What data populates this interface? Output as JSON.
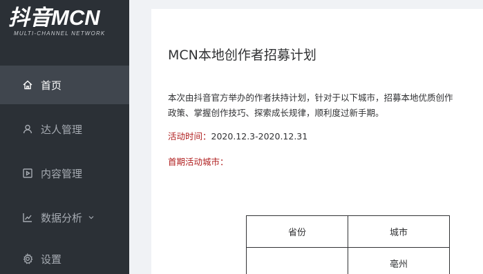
{
  "brand": {
    "logo_main": "抖音MCN",
    "logo_sub": "MULTI-CHANNEL NETWORK"
  },
  "sidebar": {
    "items": [
      {
        "label": "首页",
        "icon": "home-icon",
        "active": true
      },
      {
        "label": "达人管理",
        "icon": "user-icon",
        "active": false
      },
      {
        "label": "内容管理",
        "icon": "play-square-icon",
        "active": false
      },
      {
        "label": "数据分析",
        "icon": "line-chart-icon",
        "active": false,
        "has_dropdown": true
      },
      {
        "label": "设置",
        "icon": "gear-icon",
        "active": false
      }
    ]
  },
  "main": {
    "title": "MCN本地创作者招募计划",
    "intro_line1": "本次由抖音官方举办的作者扶持计划，针对于以下城市，招募本地优质创作",
    "intro_line2": "政策、掌握创作技巧、探索成长规律，顺利度过新手期。",
    "activity_time_label": "活动时间：",
    "activity_time_value": "2020.12.3-2020.12.31",
    "cities_label": "首期活动城市：",
    "table": {
      "headers": [
        "省份",
        "城市"
      ],
      "rows": [
        [
          "",
          "亳州"
        ]
      ]
    }
  },
  "colors": {
    "sidebar_bg": "#2b3036",
    "sidebar_active_bg": "#40464e",
    "accent_red": "#b01f1f"
  }
}
